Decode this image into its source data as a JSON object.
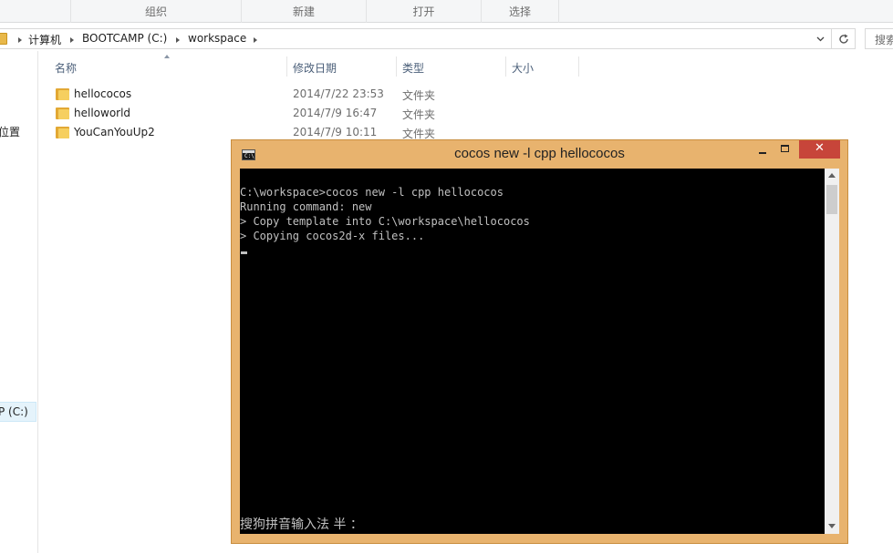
{
  "explorer": {
    "ribbon": {
      "groups": [
        "组织",
        "新建",
        "打开",
        "选择"
      ]
    },
    "address": {
      "crumbs": [
        "计算机",
        "BOOTCAMP (C:)",
        "workspace"
      ]
    },
    "search": {
      "label": "搜索"
    },
    "nav": {
      "items": [
        {
          "label": "位置"
        },
        {
          "label": "P (C:)"
        }
      ]
    },
    "columns": [
      "名称",
      "修改日期",
      "类型",
      "大小"
    ],
    "files": [
      {
        "name": "hellococos",
        "date": "2014/7/22 23:53",
        "type": "文件夹"
      },
      {
        "name": "helloworld",
        "date": "2014/7/9 16:47",
        "type": "文件夹"
      },
      {
        "name": "YouCanYouUp2",
        "date": "2014/7/9 10:11",
        "type": "文件夹"
      }
    ]
  },
  "console": {
    "icon_text": "C:\\",
    "title": "cocos  new -l cpp hellococos",
    "buttons": {
      "close_glyph": "✕"
    },
    "lines": [
      "C:\\workspace>cocos new -l cpp hellococos",
      "Running command: new",
      "> Copy template into C:\\workspace\\hellococos",
      "> Copying cocos2d-x files..."
    ],
    "ime_status": "搜狗拼音输入法 半 ：",
    "colors": {
      "frame": "#e8b36e",
      "close": "#c7453a",
      "background": "#000000",
      "text": "#c0c0c0"
    }
  }
}
